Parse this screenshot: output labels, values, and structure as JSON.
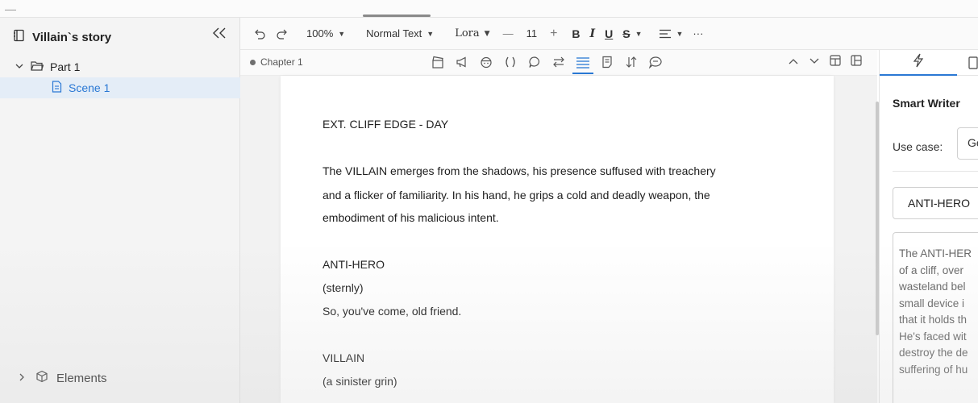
{
  "sidebar": {
    "project_title": "Villain`s story",
    "tree": {
      "part_label": "Part 1",
      "scene_label": "Scene 1"
    },
    "elements_label": "Elements"
  },
  "toolbar": {
    "undo_icon": "undo-icon",
    "redo_icon": "redo-icon",
    "zoom": "100%",
    "text_style": "Normal Text",
    "font": "Lora",
    "font_size": "11",
    "minus": "—",
    "plus": "+",
    "bold": "B",
    "italic": "I",
    "underline": "U",
    "strike": "S",
    "more": "···"
  },
  "subbar": {
    "chapter_label": "Chapter 1"
  },
  "script": {
    "lines": [
      "EXT. CLIFF EDGE - DAY",
      "The VILLAIN emerges from the shadows, his presence suffused with treachery",
      "and a flicker of familiarity. In his hand, he grips a cold and deadly weapon, the",
      "embodiment of his malicious intent.",
      "ANTI-HERO",
      "(sternly)",
      "So, you've come, old friend.",
      "VILLAIN",
      "(a sinister grin)"
    ]
  },
  "smart_writer": {
    "title": "Smart Writer",
    "use_case_label": "Use case:",
    "use_case_value": "Ge",
    "character_chip": "ANTI-HERO",
    "generated_lines": [
      "The ANTI-HER",
      "of a cliff, over",
      "wasteland bel",
      "small device i",
      "that it holds th",
      "He's faced wit",
      "destroy the de",
      "suffering of hu"
    ]
  },
  "colors": {
    "accent": "#2a78d4",
    "selected_row_bg": "#e4edf7",
    "sidebar_bg": "#f4f4f4"
  }
}
